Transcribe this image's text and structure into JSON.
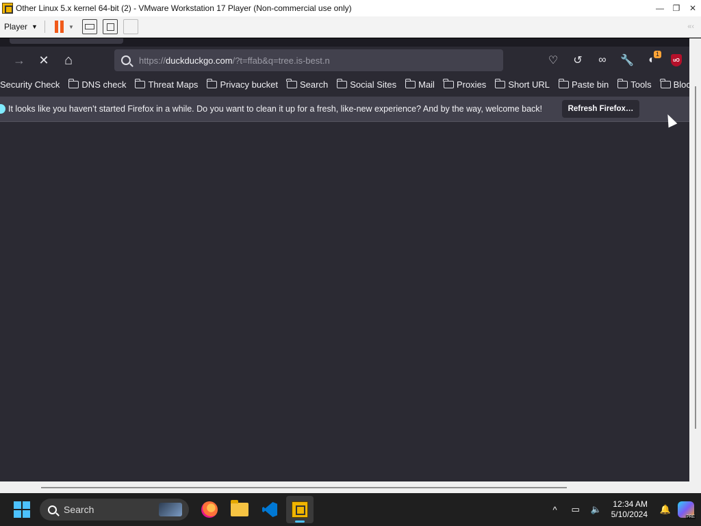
{
  "vmware": {
    "title": "Other Linux 5.x kernel 64-bit (2) - VMware Workstation 17 Player (Non-commercial use only)",
    "window_controls": {
      "minimize": "—",
      "restore": "❐",
      "close": "✕"
    },
    "toolbar": {
      "player_label": "Player"
    }
  },
  "firefox": {
    "nav": {
      "forward_glyph": "→",
      "stop_glyph": "✕",
      "home_glyph": "⌂"
    },
    "url": {
      "prefix": "https://",
      "host": "duckduckgo.com",
      "path": "/?t=ffab&q=tree.is-best.n"
    },
    "toolbar_icons": [
      {
        "name": "pocket-icon",
        "glyph": "♡"
      },
      {
        "name": "history-icon",
        "glyph": "↺"
      },
      {
        "name": "private-browsing-icon",
        "glyph": "∞"
      },
      {
        "name": "tools-icon",
        "glyph": "🔧"
      },
      {
        "name": "extension-icon",
        "glyph": "◐",
        "badge": "1"
      },
      {
        "name": "ublock-origin-icon",
        "glyph": "uO"
      }
    ],
    "bookmarks": [
      {
        "label": "Security Check",
        "folder": false
      },
      {
        "label": "DNS check",
        "folder": true
      },
      {
        "label": "Threat Maps",
        "folder": true
      },
      {
        "label": "Privacy bucket",
        "folder": true
      },
      {
        "label": "Search",
        "folder": true
      },
      {
        "label": "Social Sites",
        "folder": true
      },
      {
        "label": "Mail",
        "folder": true
      },
      {
        "label": "Proxies",
        "folder": true
      },
      {
        "label": "Short URL",
        "folder": true
      },
      {
        "label": "Paste bin",
        "folder": true
      },
      {
        "label": "Tools",
        "folder": true
      },
      {
        "label": "Blockchain",
        "folder": true
      }
    ],
    "notification": {
      "message": "It looks like you haven’t started Firefox in a while. Do you want to clean it up for a fresh, like-new experience? And by the way, welcome back!",
      "button": "Refresh Firefox…"
    }
  },
  "taskbar": {
    "search_placeholder": "Search",
    "apps": [
      "firefox-icon",
      "file-explorer-icon",
      "vscode-icon",
      "vmware-icon"
    ],
    "tray": {
      "chevron": "^",
      "time": "12:34 AM",
      "date": "5/10/2024"
    }
  },
  "colors": {
    "firefox_bg": "#2b2a33",
    "urlbar_bg": "#42414d",
    "accent": "#4cc2ff",
    "pause_orange": "#f05a1a"
  }
}
